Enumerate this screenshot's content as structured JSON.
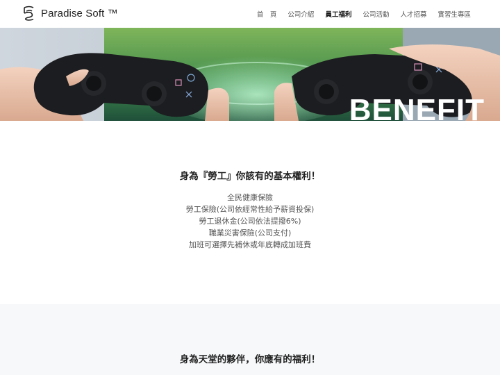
{
  "header": {
    "brand": "Paradise Soft ™",
    "nav": [
      {
        "label": "首　頁",
        "active": false
      },
      {
        "label": "公司介紹",
        "active": false
      },
      {
        "label": "員工福利",
        "active": true
      },
      {
        "label": "公司活動",
        "active": false
      },
      {
        "label": "人才招募",
        "active": false
      },
      {
        "label": "實習生專區",
        "active": false
      }
    ]
  },
  "hero": {
    "title": "BENEFIT"
  },
  "section1": {
    "title": "身為『勞工』你該有的基本權利！",
    "items": [
      "全民健康保險",
      "勞工保險(公司依經常性給予薪資投保)",
      "勞工退休金(公司依法提撥6%)",
      "職業災害保險(公司支付)",
      "加班可選擇先補休或年底轉成加班費"
    ]
  },
  "section2": {
    "title": "身為天堂的夥伴，你應有的福利！"
  },
  "colors": {
    "background": "#ffffff",
    "section_alt": "#f7f8fa",
    "text": "#333333"
  }
}
